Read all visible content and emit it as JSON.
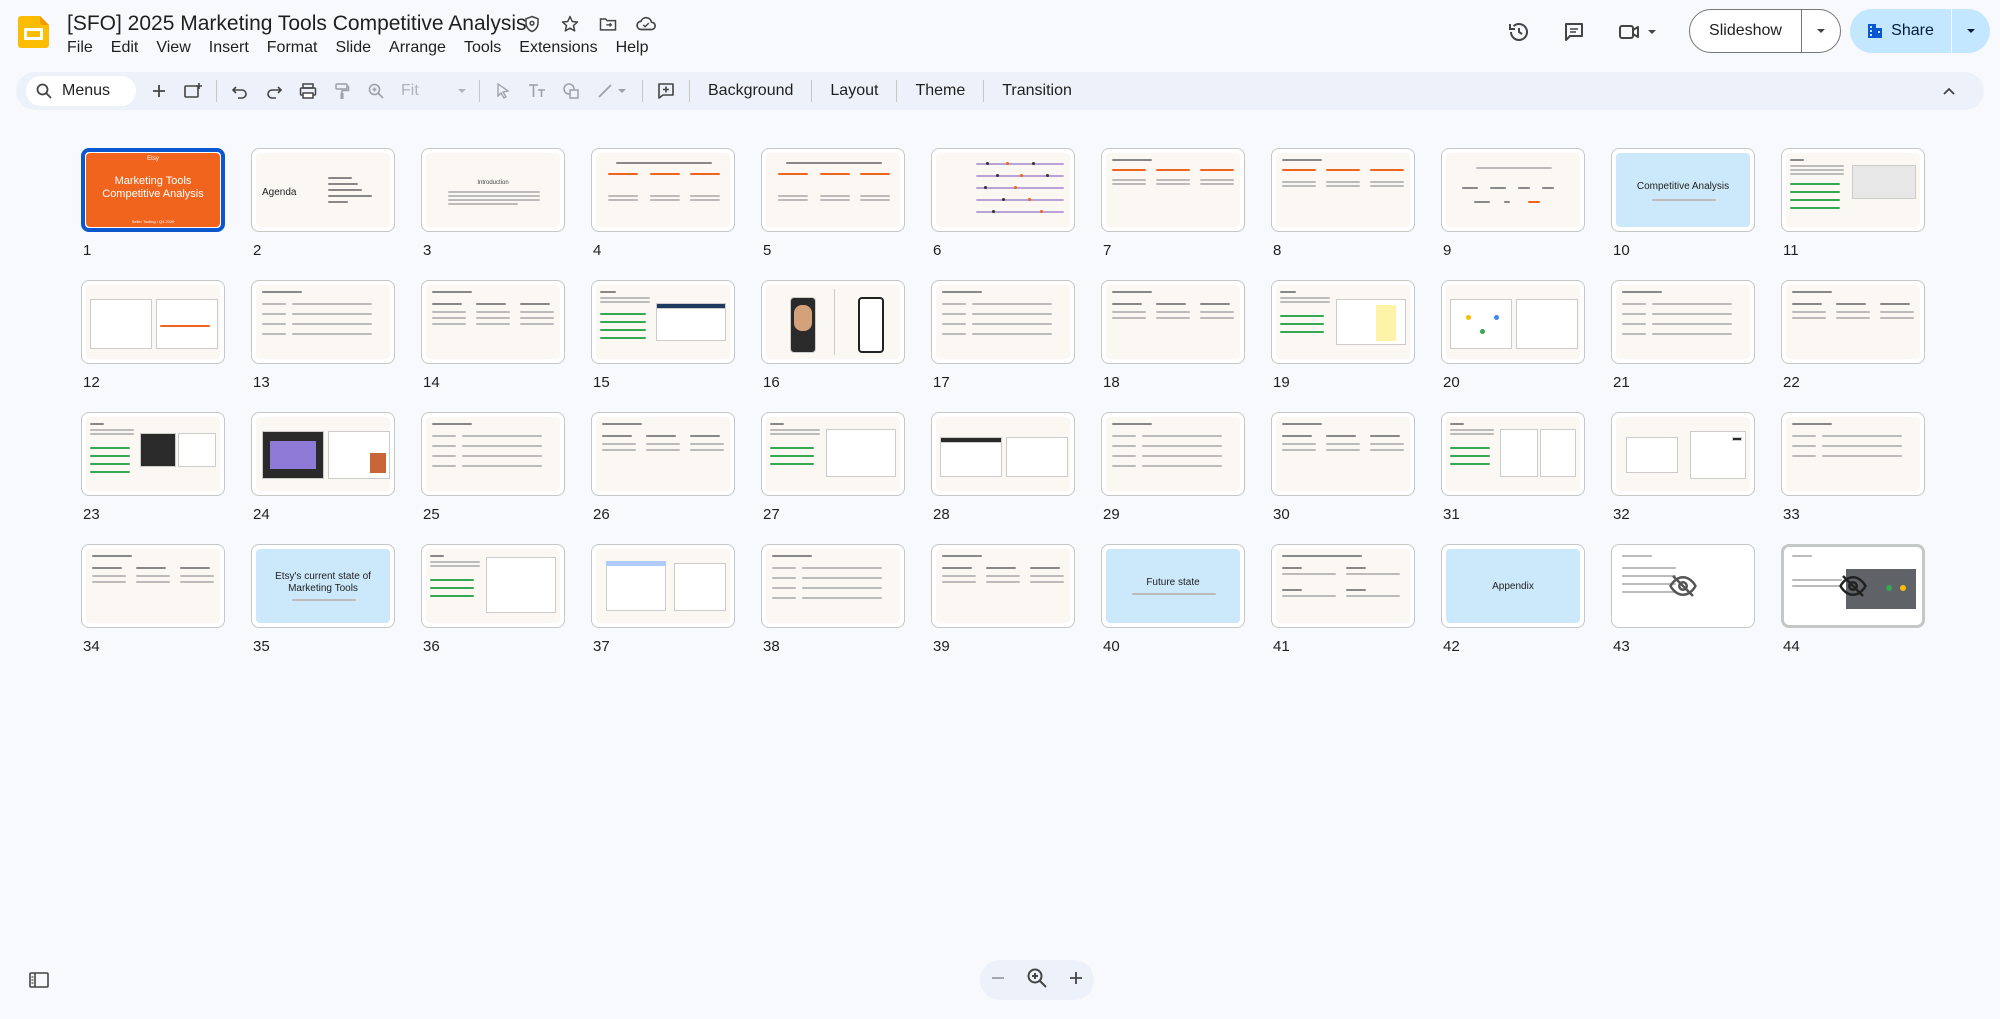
{
  "doc": {
    "title": "[SFO] 2025 Marketing Tools Competitive Analysis"
  },
  "menu": [
    "File",
    "Edit",
    "View",
    "Insert",
    "Format",
    "Slide",
    "Arrange",
    "Tools",
    "Extensions",
    "Help"
  ],
  "actions": {
    "slideshow_label": "Slideshow",
    "share_label": "Share"
  },
  "toolbar": {
    "menus_label": "Menus",
    "fit_label": "Fit",
    "background_label": "Background",
    "layout_label": "Layout",
    "theme_label": "Theme",
    "transition_label": "Transition"
  },
  "slides": {
    "s1": {
      "num": "1",
      "kicker": "Etsy",
      "title": "Marketing Tools Competitive Analysis",
      "sub": "Seller Tooling / Q4 2025"
    },
    "s2": {
      "num": "2",
      "title": "Agenda"
    },
    "s3": {
      "num": "3",
      "title": "Introduction"
    },
    "s4": {
      "num": "4"
    },
    "s5": {
      "num": "5"
    },
    "s6": {
      "num": "6"
    },
    "s7": {
      "num": "7"
    },
    "s8": {
      "num": "8"
    },
    "s9": {
      "num": "9"
    },
    "s10": {
      "num": "10",
      "title": "Competitive Analysis"
    },
    "s11": {
      "num": "11"
    },
    "s12": {
      "num": "12"
    },
    "s13": {
      "num": "13"
    },
    "s14": {
      "num": "14"
    },
    "s15": {
      "num": "15"
    },
    "s16": {
      "num": "16"
    },
    "s17": {
      "num": "17"
    },
    "s18": {
      "num": "18"
    },
    "s19": {
      "num": "19"
    },
    "s20": {
      "num": "20"
    },
    "s21": {
      "num": "21"
    },
    "s22": {
      "num": "22"
    },
    "s23": {
      "num": "23"
    },
    "s24": {
      "num": "24"
    },
    "s25": {
      "num": "25"
    },
    "s26": {
      "num": "26"
    },
    "s27": {
      "num": "27"
    },
    "s28": {
      "num": "28"
    },
    "s29": {
      "num": "29"
    },
    "s30": {
      "num": "30"
    },
    "s31": {
      "num": "31"
    },
    "s32": {
      "num": "32"
    },
    "s33": {
      "num": "33"
    },
    "s34": {
      "num": "34"
    },
    "s35": {
      "num": "35",
      "title": "Etsy's current state of Marketing Tools"
    },
    "s36": {
      "num": "36"
    },
    "s37": {
      "num": "37"
    },
    "s38": {
      "num": "38"
    },
    "s39": {
      "num": "39"
    },
    "s40": {
      "num": "40",
      "title": "Future state"
    },
    "s41": {
      "num": "41"
    },
    "s42": {
      "num": "42",
      "title": "Appendix"
    },
    "s43": {
      "num": "43"
    },
    "s44": {
      "num": "44"
    }
  },
  "icons": {
    "app": "google-slides-logo",
    "title_icons": [
      "status-icon",
      "star-icon",
      "move-folder-icon",
      "cloud-saved-icon"
    ],
    "header_right": [
      "version-history-icon",
      "comments-icon",
      "meet-icon"
    ],
    "hidden_slide": "eye-off-icon"
  },
  "colors": {
    "selected_border": "#0b57d0",
    "share_bg": "#c2e7ff",
    "etsy_orange": "#f1641e",
    "section_blue": "#cbe9fb"
  }
}
